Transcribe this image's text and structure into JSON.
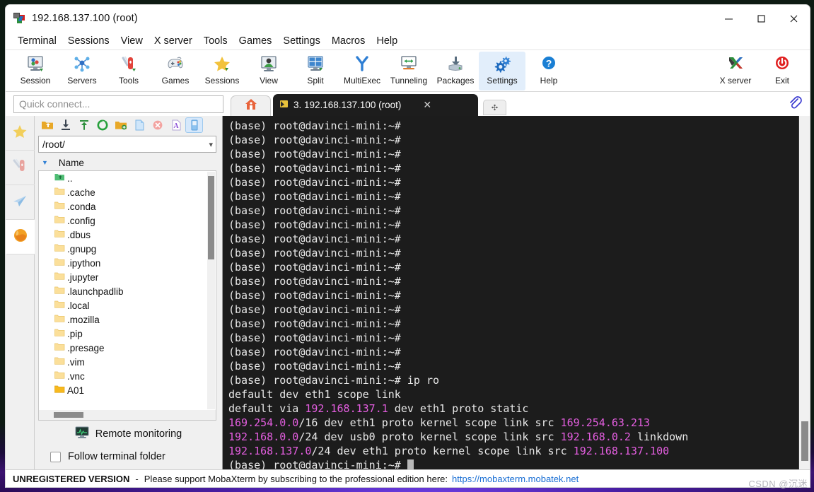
{
  "window": {
    "title": "192.168.137.100 (root)",
    "icon": "mobaxterm-icon",
    "controls": {
      "minimize": "—",
      "maximize": "□",
      "close": "✕"
    }
  },
  "menubar": {
    "items": [
      {
        "label": "Terminal",
        "name": "menu-terminal"
      },
      {
        "label": "Sessions",
        "name": "menu-sessions"
      },
      {
        "label": "View",
        "name": "menu-view"
      },
      {
        "label": "X server",
        "name": "menu-x-server"
      },
      {
        "label": "Tools",
        "name": "menu-tools"
      },
      {
        "label": "Games",
        "name": "menu-games"
      },
      {
        "label": "Settings",
        "name": "menu-settings"
      },
      {
        "label": "Macros",
        "name": "menu-macros"
      },
      {
        "label": "Help",
        "name": "menu-help"
      }
    ]
  },
  "toolbar": {
    "left": [
      {
        "label": "Session",
        "icon": "session-icon"
      },
      {
        "label": "Servers",
        "icon": "servers-icon"
      },
      {
        "label": "Tools",
        "icon": "tools-icon"
      },
      {
        "label": "Games",
        "icon": "games-icon"
      },
      {
        "label": "Sessions",
        "icon": "sessions-star-icon"
      },
      {
        "label": "View",
        "icon": "view-icon"
      },
      {
        "label": "Split",
        "icon": "split-icon"
      },
      {
        "label": "MultiExec",
        "icon": "multiexec-icon"
      },
      {
        "label": "Tunneling",
        "icon": "tunneling-icon"
      },
      {
        "label": "Packages",
        "icon": "packages-icon"
      },
      {
        "label": "Settings",
        "icon": "settings-gear-icon",
        "selected": true
      },
      {
        "label": "Help",
        "icon": "help-icon"
      }
    ],
    "right": [
      {
        "label": "X server",
        "icon": "x-server-icon"
      },
      {
        "label": "Exit",
        "icon": "exit-power-icon"
      }
    ]
  },
  "quick_connect": {
    "placeholder": "Quick connect...",
    "value": ""
  },
  "tabs": {
    "home_icon": "home-icon",
    "session": {
      "icon": "terminal-tab-icon",
      "label": "3. 192.168.137.100 (root)",
      "close": "✕"
    },
    "plus_label": "✣",
    "clip_icon": "paperclip-icon"
  },
  "rail": {
    "items": [
      {
        "name": "bookmarks-star-icon",
        "icon": "star-icon"
      },
      {
        "name": "tools-knife-icon",
        "icon": "knife-icon"
      },
      {
        "name": "sftp-plane-icon",
        "icon": "plane-icon"
      },
      {
        "name": "globe-icon",
        "icon": "globe-icon",
        "active": true
      }
    ]
  },
  "sftp": {
    "tools": [
      {
        "name": "parent-folder-icon"
      },
      {
        "name": "download-icon"
      },
      {
        "name": "upload-icon"
      },
      {
        "name": "refresh-icon"
      },
      {
        "name": "new-folder-icon"
      },
      {
        "name": "new-file-icon"
      },
      {
        "name": "delete-icon"
      },
      {
        "name": "text-mode-icon"
      },
      {
        "name": "toggle-panel-icon",
        "selected": true
      }
    ],
    "path": "/root/",
    "column_header": "Name",
    "files": [
      {
        "name": "..",
        "type": "parent"
      },
      {
        "name": ".cache",
        "type": "folder"
      },
      {
        "name": ".conda",
        "type": "folder"
      },
      {
        "name": ".config",
        "type": "folder"
      },
      {
        "name": ".dbus",
        "type": "folder"
      },
      {
        "name": ".gnupg",
        "type": "folder"
      },
      {
        "name": ".ipython",
        "type": "folder"
      },
      {
        "name": ".jupyter",
        "type": "folder"
      },
      {
        "name": ".launchpadlib",
        "type": "folder"
      },
      {
        "name": ".local",
        "type": "folder"
      },
      {
        "name": ".mozilla",
        "type": "folder"
      },
      {
        "name": ".pip",
        "type": "folder"
      },
      {
        "name": ".presage",
        "type": "folder"
      },
      {
        "name": ".vim",
        "type": "folder"
      },
      {
        "name": ".vnc",
        "type": "folder"
      },
      {
        "name": "A01",
        "type": "folder-open"
      }
    ],
    "remote_monitoring": "Remote monitoring",
    "follow_terminal_folder": "Follow terminal folder",
    "follow_checked": false
  },
  "terminal": {
    "prompt": "(base) root@davinci-mini:~#",
    "lines": [
      [
        {
          "t": "(base) root@davinci-mini:~#",
          "c": "fg"
        }
      ],
      [
        {
          "t": "(base) root@davinci-mini:~#",
          "c": "fg"
        }
      ],
      [
        {
          "t": "(base) root@davinci-mini:~#",
          "c": "fg"
        }
      ],
      [
        {
          "t": "(base) root@davinci-mini:~#",
          "c": "fg"
        }
      ],
      [
        {
          "t": "(base) root@davinci-mini:~#",
          "c": "fg"
        }
      ],
      [
        {
          "t": "(base) root@davinci-mini:~#",
          "c": "fg"
        }
      ],
      [
        {
          "t": "(base) root@davinci-mini:~#",
          "c": "fg"
        }
      ],
      [
        {
          "t": "(base) root@davinci-mini:~#",
          "c": "fg"
        }
      ],
      [
        {
          "t": "(base) root@davinci-mini:~#",
          "c": "fg"
        }
      ],
      [
        {
          "t": "(base) root@davinci-mini:~#",
          "c": "fg"
        }
      ],
      [
        {
          "t": "(base) root@davinci-mini:~#",
          "c": "fg"
        }
      ],
      [
        {
          "t": "(base) root@davinci-mini:~#",
          "c": "fg"
        }
      ],
      [
        {
          "t": "(base) root@davinci-mini:~#",
          "c": "fg"
        }
      ],
      [
        {
          "t": "(base) root@davinci-mini:~#",
          "c": "fg"
        }
      ],
      [
        {
          "t": "(base) root@davinci-mini:~#",
          "c": "fg"
        }
      ],
      [
        {
          "t": "(base) root@davinci-mini:~#",
          "c": "fg"
        }
      ],
      [
        {
          "t": "(base) root@davinci-mini:~#",
          "c": "fg"
        }
      ],
      [
        {
          "t": "(base) root@davinci-mini:~#",
          "c": "fg"
        }
      ],
      [
        {
          "t": "(base) root@davinci-mini:~# ip ro",
          "c": "fg"
        }
      ],
      [
        {
          "t": "default dev eth1 scope link",
          "c": "fg"
        }
      ],
      [
        {
          "t": "default via ",
          "c": "fg"
        },
        {
          "t": "192.168.137.1",
          "c": "pink"
        },
        {
          "t": " dev eth1 proto static",
          "c": "fg"
        }
      ],
      [
        {
          "t": "169.254.0.0",
          "c": "pink"
        },
        {
          "t": "/16 dev eth1 proto kernel scope link src ",
          "c": "fg"
        },
        {
          "t": "169.254.63.213",
          "c": "pink"
        }
      ],
      [
        {
          "t": "192.168.0.0",
          "c": "pink"
        },
        {
          "t": "/24 dev usb0 proto kernel scope link src ",
          "c": "fg"
        },
        {
          "t": "192.168.0.2",
          "c": "pink"
        },
        {
          "t": " linkdown",
          "c": "fg"
        }
      ],
      [
        {
          "t": "192.168.137.0",
          "c": "pink"
        },
        {
          "t": "/24 dev eth1 proto kernel scope link src ",
          "c": "fg"
        },
        {
          "t": "192.168.137.100",
          "c": "pink"
        }
      ],
      [
        {
          "t": "(base) root@davinci-mini:~# ",
          "c": "fg"
        },
        {
          "t": "",
          "c": "cursor"
        }
      ]
    ],
    "colors": {
      "background": "#1c1c1c",
      "foreground": "#e8e8e8",
      "magenta": "#e45ee0"
    }
  },
  "status": {
    "unregistered": "UNREGISTERED VERSION",
    "dash": "-",
    "message": "Please support MobaXterm by subscribing to the professional edition here:",
    "link": "https://mobaxterm.mobatek.net"
  },
  "watermark": "CSDN @沉迷"
}
